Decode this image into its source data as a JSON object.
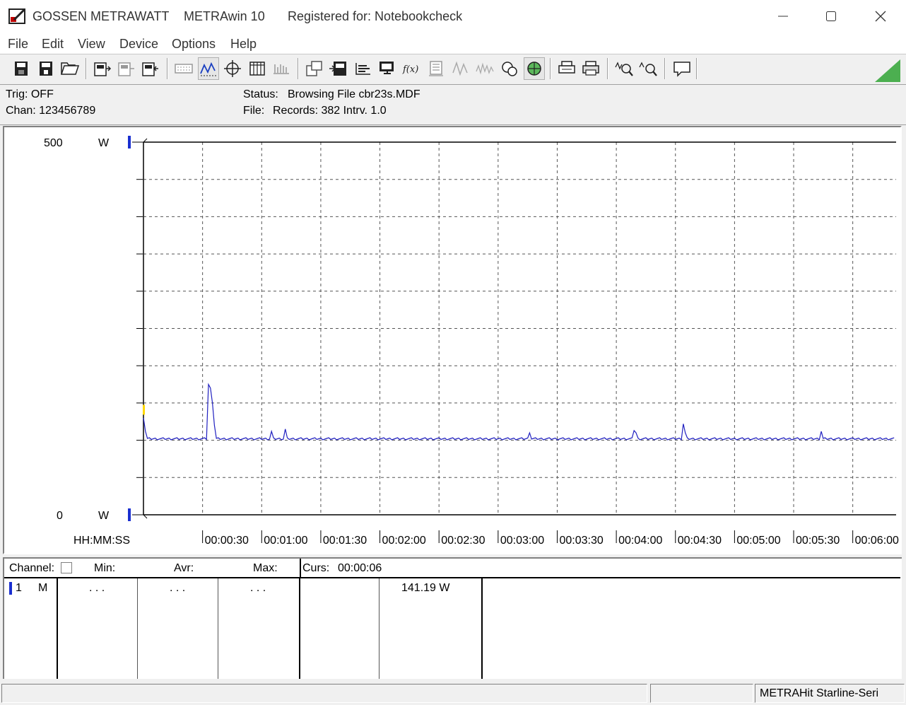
{
  "window": {
    "brand": "GOSSEN METRAWATT",
    "app_name": "METRAwin 10",
    "registered": "Registered for: Notebookcheck"
  },
  "menu": [
    "File",
    "Edit",
    "View",
    "Device",
    "Options",
    "Help"
  ],
  "toolbar_icons": [
    "save-icon",
    "save-as-icon",
    "open-folder-icon",
    "device-connect-icon",
    "device-disabled-icon",
    "device-read-icon",
    "keyboard-icon",
    "waveform-icon",
    "crosshair-icon",
    "table-icon",
    "bars-icon",
    "export-icon",
    "device-settings-icon",
    "histogram-icon",
    "monitor-icon",
    "function-icon",
    "panel-icon",
    "wave-small-icon",
    "wave-gray-icon",
    "signal-tools-icon",
    "trigger-icon",
    "print-preview-icon",
    "print-icon",
    "zoom-in-icon",
    "zoom-out-icon",
    "comment-icon"
  ],
  "info": {
    "trig": "Trig: OFF",
    "chan": "Chan:  123456789",
    "status_label": "Status:",
    "status_value": "Browsing File cbr23s.MDF",
    "file_label": "File:",
    "file_value": "Records: 382   Intrv. 1.0"
  },
  "chart_data": {
    "type": "line",
    "ytop_label": "500",
    "ybottom_label": "0",
    "yunit": "W",
    "ylim": [
      0,
      500
    ],
    "xlabel": "HH:MM:SS",
    "xlim": [
      0,
      382
    ],
    "xticks": [
      "00:00:30",
      "00:01:00",
      "00:01:30",
      "00:02:00",
      "00:02:30",
      "00:03:00",
      "00:03:30",
      "00:04:00",
      "00:04:30",
      "00:05:00",
      "00:05:30",
      "00:06:00"
    ],
    "grid": true,
    "series": [
      {
        "color": "#2020c0",
        "baseline": 102,
        "spikes": [
          {
            "t": 0,
            "v": 130
          },
          {
            "t": 1,
            "v": 112
          },
          {
            "t": 33,
            "v": 175
          },
          {
            "t": 34,
            "v": 170
          },
          {
            "t": 35,
            "v": 150
          },
          {
            "t": 36,
            "v": 120
          },
          {
            "t": 65,
            "v": 112
          },
          {
            "t": 72,
            "v": 115
          },
          {
            "t": 196,
            "v": 110
          },
          {
            "t": 249,
            "v": 113
          },
          {
            "t": 250,
            "v": 110
          },
          {
            "t": 274,
            "v": 122
          },
          {
            "t": 275,
            "v": 110
          },
          {
            "t": 344,
            "v": 112
          }
        ]
      }
    ]
  },
  "table": {
    "headers": {
      "channel": "Channel:",
      "min": "Min:",
      "avr": "Avr:",
      "max": "Max:",
      "curs": "Curs:",
      "curs_time": "00:00:06"
    },
    "row": {
      "num": "1",
      "mode": "M",
      "min": ". . .",
      "avr": ". . .",
      "max": ". . .",
      "cursor_value": "141.19  W"
    }
  },
  "statusbar": {
    "device": "METRAHit Starline-Seri"
  }
}
